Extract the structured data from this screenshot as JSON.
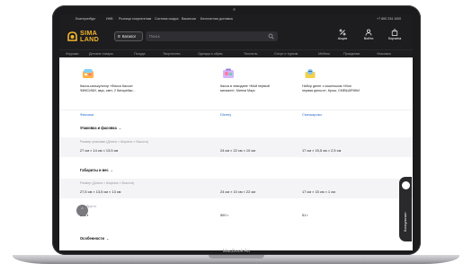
{
  "device": {
    "model_label": "MacBook Air"
  },
  "topbar": {
    "city": "Екатеринбург",
    "link_1": "ИНВ",
    "link_2": "Розница покупателям",
    "link_3": "Система скидок",
    "link_4": "Вакансии",
    "link_5": "Бесплатная доставка",
    "phone": "+7 800 234 1000"
  },
  "header": {
    "logo_line1": "SIMA",
    "logo_line2": "LAND",
    "catalog_label": "Каталог",
    "search_placeholder": "Поиск",
    "actions": [
      {
        "label": "Акции",
        "icon": "percent-icon"
      },
      {
        "label": "Войти",
        "icon": "user-icon"
      },
      {
        "label": "Корзина",
        "icon": "bag-icon"
      }
    ]
  },
  "nav": {
    "items": [
      "Игрушки",
      "Детские товары",
      "Посуда",
      "Творчество",
      "Одежда и обувь",
      "Текстиль",
      "Спорт и туризм",
      "Мебель",
      "Праздники",
      "Упаковка"
    ]
  },
  "products": [
    {
      "name": "Касса-калькулятор «Фикси Касса»\nФИКСИКИ, звук, свет, 2 батарейки...",
      "brand": "Фиксики"
    },
    {
      "name": "Касса в чемодане «Мой первый\nмагазин», Минни Маус",
      "brand": "Disney"
    },
    {
      "name": "Набор денег с кошельком «Моя\nпервая деньги», Крош, СМЕШАРИКИ",
      "brand": "Смешарики"
    }
  ],
  "sections": {
    "packaging": {
      "title": "Упаковка и фасовка",
      "size_label": "Размер упаковки (Длина × Ширина × Высота)",
      "sizes": [
        "27 см × 14 см × 13,5 см",
        "24 см × 22 см × 10 см",
        "17 см × 15,5 см × 2,5 см"
      ]
    },
    "dimensions": {
      "title": "Габариты и вес",
      "size_label": "Размер (Длина × Ширина × Высота)",
      "sizes": [
        "27,5 см × 13,5 см × 13 см",
        "24 см × 10 см × 22 см",
        "17 см × 15 см × 1 см"
      ],
      "weight_label": "Вес брутто",
      "weights": [
        "263 г",
        "500 г",
        "51 г"
      ]
    },
    "features": {
      "title": "Особенности"
    }
  },
  "consultant": {
    "label": "Консультант"
  },
  "colors": {
    "header_bg": "#1d1d1f",
    "logo_gold": "#f3b52b",
    "brand_link": "#2f6fd0"
  }
}
